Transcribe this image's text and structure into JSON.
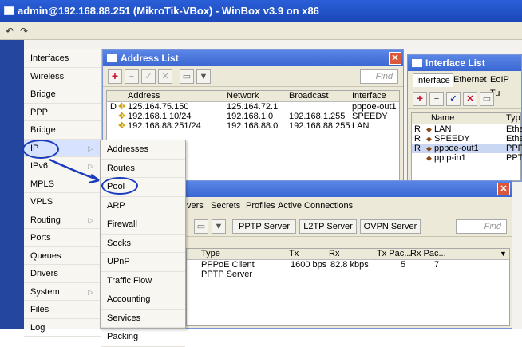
{
  "window": {
    "title": "admin@192.168.88.251 (MikroTik-VBox) - WinBox v3.9 on x86"
  },
  "toolbar": {
    "undo": "↶",
    "redo": "↷"
  },
  "menu": {
    "items": [
      {
        "label": "Interfaces"
      },
      {
        "label": "Wireless"
      },
      {
        "label": "Bridge"
      },
      {
        "label": "PPP"
      },
      {
        "label": "Bridge"
      },
      {
        "label": "IP",
        "arrow": "▷"
      },
      {
        "label": "IPv6",
        "arrow": "▷"
      },
      {
        "label": "MPLS"
      },
      {
        "label": "VPLS"
      },
      {
        "label": "Routing",
        "arrow": "▷"
      },
      {
        "label": "Ports"
      },
      {
        "label": "Queues"
      },
      {
        "label": "Drivers"
      },
      {
        "label": "System",
        "arrow": "▷"
      },
      {
        "label": "Files"
      },
      {
        "label": "Log"
      }
    ]
  },
  "submenu": {
    "items": [
      "Addresses",
      "Routes",
      "Pool",
      "ARP",
      "Firewall",
      "Socks",
      "UPnP",
      "Traffic Flow",
      "Accounting",
      "Services",
      "Packing"
    ]
  },
  "address_list": {
    "title": "Address List",
    "find_placeholder": "Find",
    "columns": [
      "Address",
      "Network",
      "Broadcast",
      "Interface"
    ],
    "rows": [
      {
        "flag": "D",
        "address": "125.164.75.150",
        "network": "125.164.72.1",
        "broadcast": "",
        "interface": "pppoe-out1"
      },
      {
        "flag": "",
        "address": "192.168.1.10/24",
        "network": "192.168.1.0",
        "broadcast": "192.168.1.255",
        "interface": "SPEEDY"
      },
      {
        "flag": "",
        "address": "192.168.88.251/24",
        "network": "192.168.88.0",
        "broadcast": "192.168.88.255",
        "interface": "LAN"
      }
    ]
  },
  "interface_list": {
    "title": "Interface List",
    "tabs": [
      "Interface",
      "Ethernet",
      "EoIP Tu"
    ],
    "columns": [
      "Name",
      "Typ"
    ],
    "rows": [
      {
        "flag": "R",
        "name": "LAN",
        "type": "Ethe"
      },
      {
        "flag": "R",
        "name": "SPEEDY",
        "type": "Ethe"
      },
      {
        "flag": "R",
        "name": "pppoe-out1",
        "type": "PPP"
      },
      {
        "flag": "",
        "name": "pptp-in1",
        "type": "PPT"
      }
    ]
  },
  "ppp": {
    "tabs": [
      "vers",
      "Secrets",
      "Profiles",
      "Active Connections"
    ],
    "buttons": [
      "PPTP Server",
      "L2TP Server",
      "OVPN Server"
    ],
    "find_placeholder": "Find",
    "columns": [
      "Type",
      "Tx",
      "Rx",
      "Tx Pac...",
      "Rx Pac..."
    ],
    "rows": [
      {
        "type": "PPPoE Client",
        "tx": "1600 bps",
        "rx": "82.8 kbps",
        "txp": "5",
        "rxp": "7"
      },
      {
        "type": "PPTP Server",
        "tx": "",
        "rx": "",
        "txp": "",
        "rxp": ""
      }
    ]
  },
  "colors": {
    "titlebar": "#1b47b8",
    "sidebar": "#24469e",
    "annotation": "#1a3bbf",
    "close": "#d9583c",
    "add": "#c8102e",
    "check": "#1a3bbf"
  }
}
